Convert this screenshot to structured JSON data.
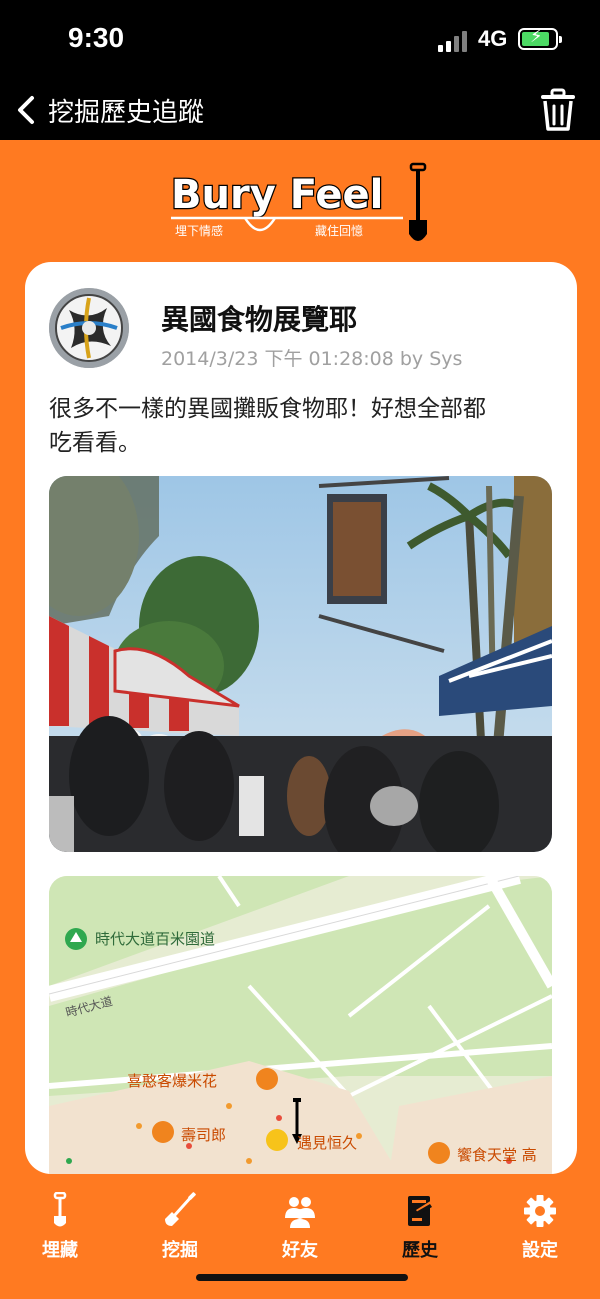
{
  "status_bar": {
    "time": "9:30",
    "network": "4G"
  },
  "nav": {
    "title": "挖掘歷史追蹤"
  },
  "logo": {
    "text": "Bury Feel",
    "tagline_left": "埋下情感",
    "tagline_right": "藏住回憶"
  },
  "post": {
    "title": "異國食物展覽耶",
    "meta": "2014/3/23 下午 01:28:08 by Sys",
    "body": "很多不一樣的異國攤販食物耶！好想全部都吃看看。"
  },
  "map": {
    "labels": [
      "時代大道百米園道",
      "時代大道",
      "喜憨客爆米花",
      "壽司郎",
      "遇見恒久",
      "饗食天堂 高"
    ]
  },
  "tabs": [
    {
      "label": "埋藏",
      "icon": "shovel-icon"
    },
    {
      "label": "挖掘",
      "icon": "dig-icon"
    },
    {
      "label": "好友",
      "icon": "friends-icon"
    },
    {
      "label": "歷史",
      "icon": "history-icon"
    },
    {
      "label": "設定",
      "icon": "gear-icon"
    }
  ],
  "colors": {
    "accent": "#ff7a21",
    "nav_background": "#000000",
    "active_tab": "#111111"
  }
}
